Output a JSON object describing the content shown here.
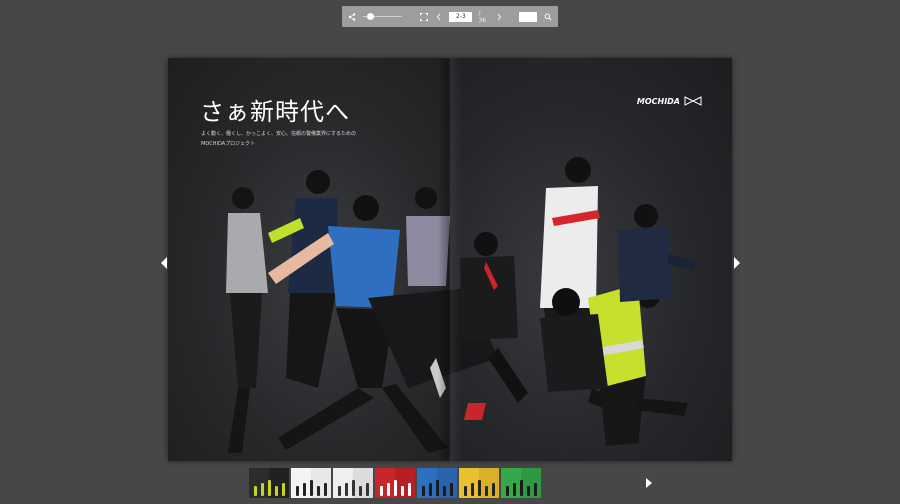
{
  "toolbar": {
    "share_icon": "share-icon",
    "fullscreen_icon": "fullscreen-icon",
    "prev_icon": "chevron-left-icon",
    "next_icon": "chevron-right-icon",
    "search_icon": "search-icon",
    "zoom_level": 0.1,
    "page_value": "2-3",
    "page_total": "/ 36",
    "search_value": ""
  },
  "spread": {
    "headline": "さぁ新時代へ",
    "subcopy_line1": "よく動く、働くし、かっこよく、安心。信頼の警備業界にするための",
    "subcopy_line2": "MOCHIDAプロジェクト",
    "brand": "MOCHIDA"
  },
  "thumbnails": [
    {
      "left": "#2a2c2e",
      "right": "#1f2123",
      "accent": "#c7d22a"
    },
    {
      "left": "#f4f4f4",
      "right": "#e8e8e8",
      "accent": "#222222"
    },
    {
      "left": "#efefef",
      "right": "#dcdcdc",
      "accent": "#333333"
    },
    {
      "left": "#c8262b",
      "right": "#b81f24",
      "accent": "#ffffff"
    },
    {
      "left": "#2f6fc2",
      "right": "#2a63ad",
      "accent": "#1b1b1b"
    },
    {
      "left": "#e9c12f",
      "right": "#d9b028",
      "accent": "#222222"
    },
    {
      "left": "#35a84a",
      "right": "#2f9842",
      "accent": "#1b1b1b"
    }
  ],
  "colors": {
    "background": "#474747",
    "toolbar": "#9d9d9d",
    "accent_blue": "#2f6fc2",
    "accent_neon": "#c7e02e",
    "accent_red": "#d6262b"
  }
}
